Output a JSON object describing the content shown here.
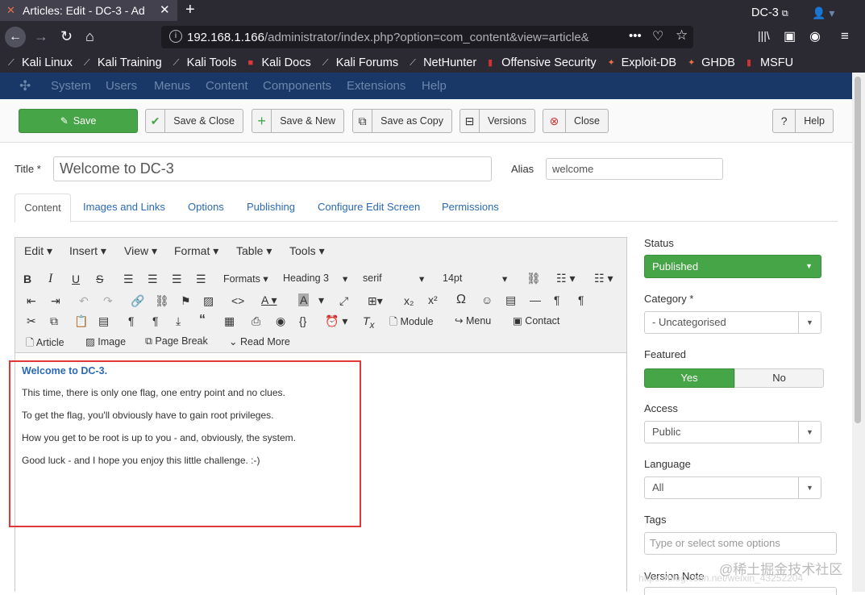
{
  "browser": {
    "tab_title": "Articles: Edit - DC-3 - Ad",
    "url_host": "192.168.1.166",
    "url_path": "/administrator/index.php?option=com_content&view=article&",
    "bookmarks": [
      "Kali Linux",
      "Kali Training",
      "Kali Tools",
      "Kali Docs",
      "Kali Forums",
      "NetHunter",
      "Offensive Security",
      "Exploit-DB",
      "GHDB",
      "MSFU"
    ]
  },
  "admin_menu": {
    "items": [
      "System",
      "Users",
      "Menus",
      "Content",
      "Components",
      "Extensions",
      "Help"
    ],
    "site_name": "DC-3",
    "site_link_icon": "external-link-icon"
  },
  "toolbar": {
    "save": "Save",
    "save_close": "Save & Close",
    "save_new": "Save & New",
    "save_copy": "Save as Copy",
    "versions": "Versions",
    "close": "Close",
    "help": "Help"
  },
  "form": {
    "title_label": "Title *",
    "title_value": "Welcome to DC-3",
    "alias_label": "Alias",
    "alias_value": "welcome"
  },
  "tabs": [
    "Content",
    "Images and Links",
    "Options",
    "Publishing",
    "Configure Edit Screen",
    "Permissions"
  ],
  "editor": {
    "menubar": [
      "Edit",
      "Insert",
      "View",
      "Format",
      "Table",
      "Tools"
    ],
    "formats_label": "Formats",
    "block_format": "Heading 3",
    "font_family": "serif",
    "font_size": "14pt",
    "buttons_row4": [
      "Module",
      "Menu",
      "Contact"
    ],
    "buttons_row5": [
      "Article",
      "Image",
      "Page Break",
      "Read More"
    ],
    "content": {
      "heading": "Welcome to DC-3.",
      "paragraphs": [
        "This time, there is only one flag, one entry point and no clues.",
        "To get the flag, you'll obviously have to gain root privileges.",
        "How you get to be root is up to you - and, obviously, the system.",
        "Good luck - and I hope you enjoy this little challenge.  :-)"
      ]
    }
  },
  "sidebar": {
    "status_label": "Status",
    "status_value": "Published",
    "category_label": "Category *",
    "category_value": "- Uncategorised",
    "featured_label": "Featured",
    "featured_yes": "Yes",
    "featured_no": "No",
    "access_label": "Access",
    "access_value": "Public",
    "language_label": "Language",
    "language_value": "All",
    "tags_label": "Tags",
    "tags_placeholder": "Type or select some options",
    "version_note_label": "Version Note"
  },
  "colors": {
    "success": "#46a546",
    "admin_bar": "#1a3867",
    "link": "#2a69b8",
    "highlight_box": "#e0383a"
  },
  "watermark": {
    "text": "@稀土掘金技术社区",
    "faint": "https://blog.csdn.net/weixin_43252204"
  }
}
